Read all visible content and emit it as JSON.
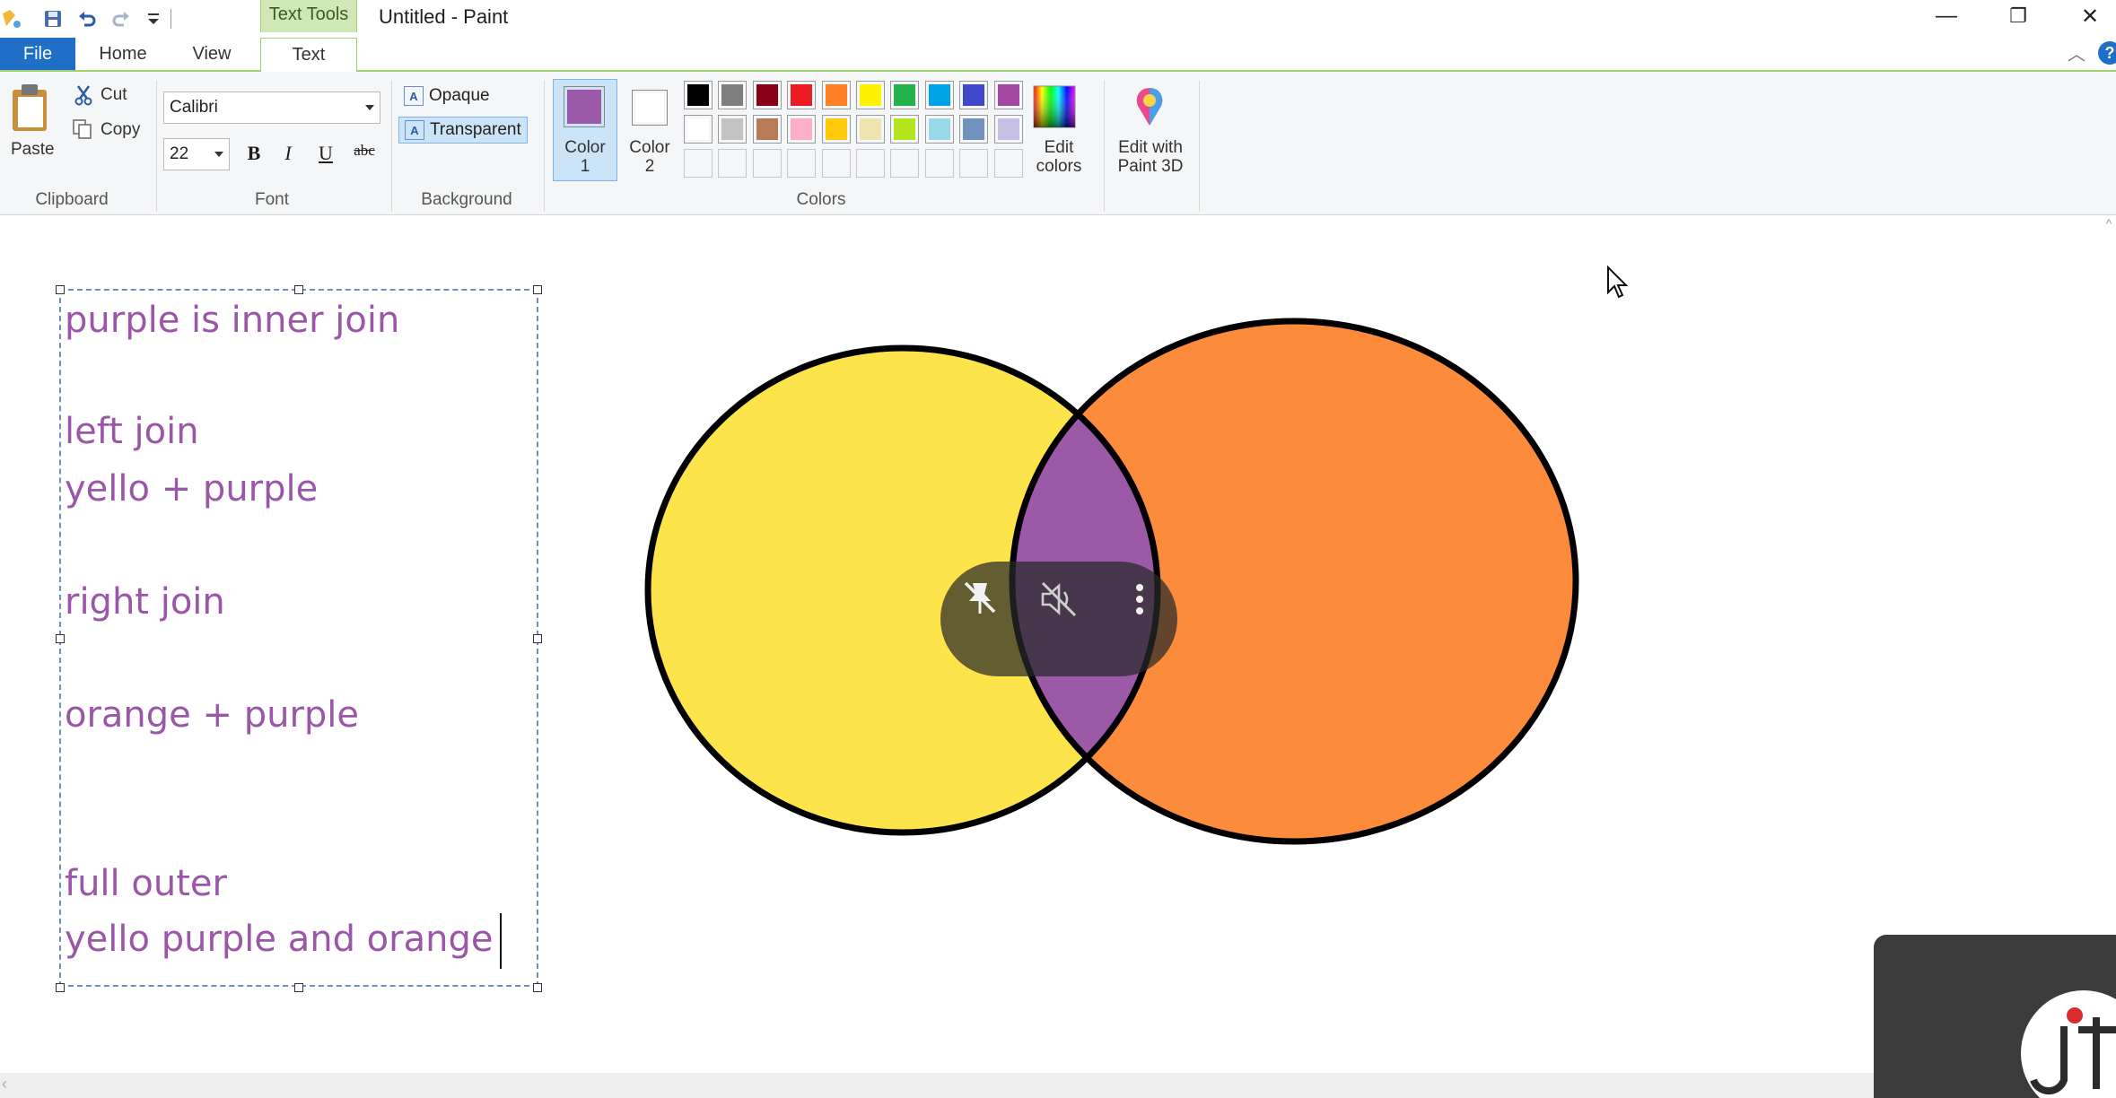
{
  "window": {
    "title": "Untitled - Paint",
    "contextual_tab_group": "Text Tools",
    "controls": {
      "minimize": "—",
      "restore": "❐",
      "close": "✕"
    }
  },
  "tabs": {
    "file": "File",
    "home": "Home",
    "view": "View",
    "text": "Text",
    "help": "?"
  },
  "ribbon": {
    "clipboard": {
      "label": "Clipboard",
      "paste": "Paste",
      "cut": "Cut",
      "copy": "Copy"
    },
    "font": {
      "label": "Font",
      "family": "Calibri",
      "size": "22",
      "bold": "B",
      "italic": "I",
      "underline": "U",
      "strikethrough": "abc"
    },
    "background": {
      "label": "Background",
      "opaque": "Opaque",
      "transparent": "Transparent",
      "selected": "Transparent"
    },
    "colors": {
      "label": "Colors",
      "color1_label": "Color\n1",
      "color2_label": "Color\n2",
      "color1": "#9b59a8",
      "color2": "#ffffff",
      "palette_row1": [
        "#000000",
        "#7f7f7f",
        "#880015",
        "#ed1c24",
        "#ff7f27",
        "#fff200",
        "#22b14c",
        "#00a2e8",
        "#3f48cc",
        "#a349a4"
      ],
      "palette_row2": [
        "#ffffff",
        "#c3c3c3",
        "#b97a57",
        "#ffaec9",
        "#ffc90e",
        "#efe4b0",
        "#b5e61d",
        "#99d9ea",
        "#7092be",
        "#c8bfe7"
      ],
      "palette_row3": [
        "#ffffff",
        "#ffffff",
        "#ffffff",
        "#ffffff",
        "#ffffff",
        "#ffffff",
        "#ffffff",
        "#ffffff",
        "#ffffff",
        "#ffffff"
      ],
      "edit_colors": "Edit\ncolors",
      "edit_paint3d": "Edit with\nPaint 3D"
    }
  },
  "canvas": {
    "text_lines": [
      "purple is inner join",
      "left join",
      "yello +  purple",
      "right join",
      "orange + purple",
      "full outer",
      "yello purple and orange"
    ],
    "venn": {
      "left_color": "#fde44a",
      "right_color": "#fc8c3c",
      "overlap_color": "#9b59a8",
      "outline_color": "#000000"
    }
  },
  "overlay": {
    "pin_icon": "unpin-icon",
    "mute_icon": "muted-speaker-icon",
    "menu_icon": "more-vertical-icon"
  }
}
